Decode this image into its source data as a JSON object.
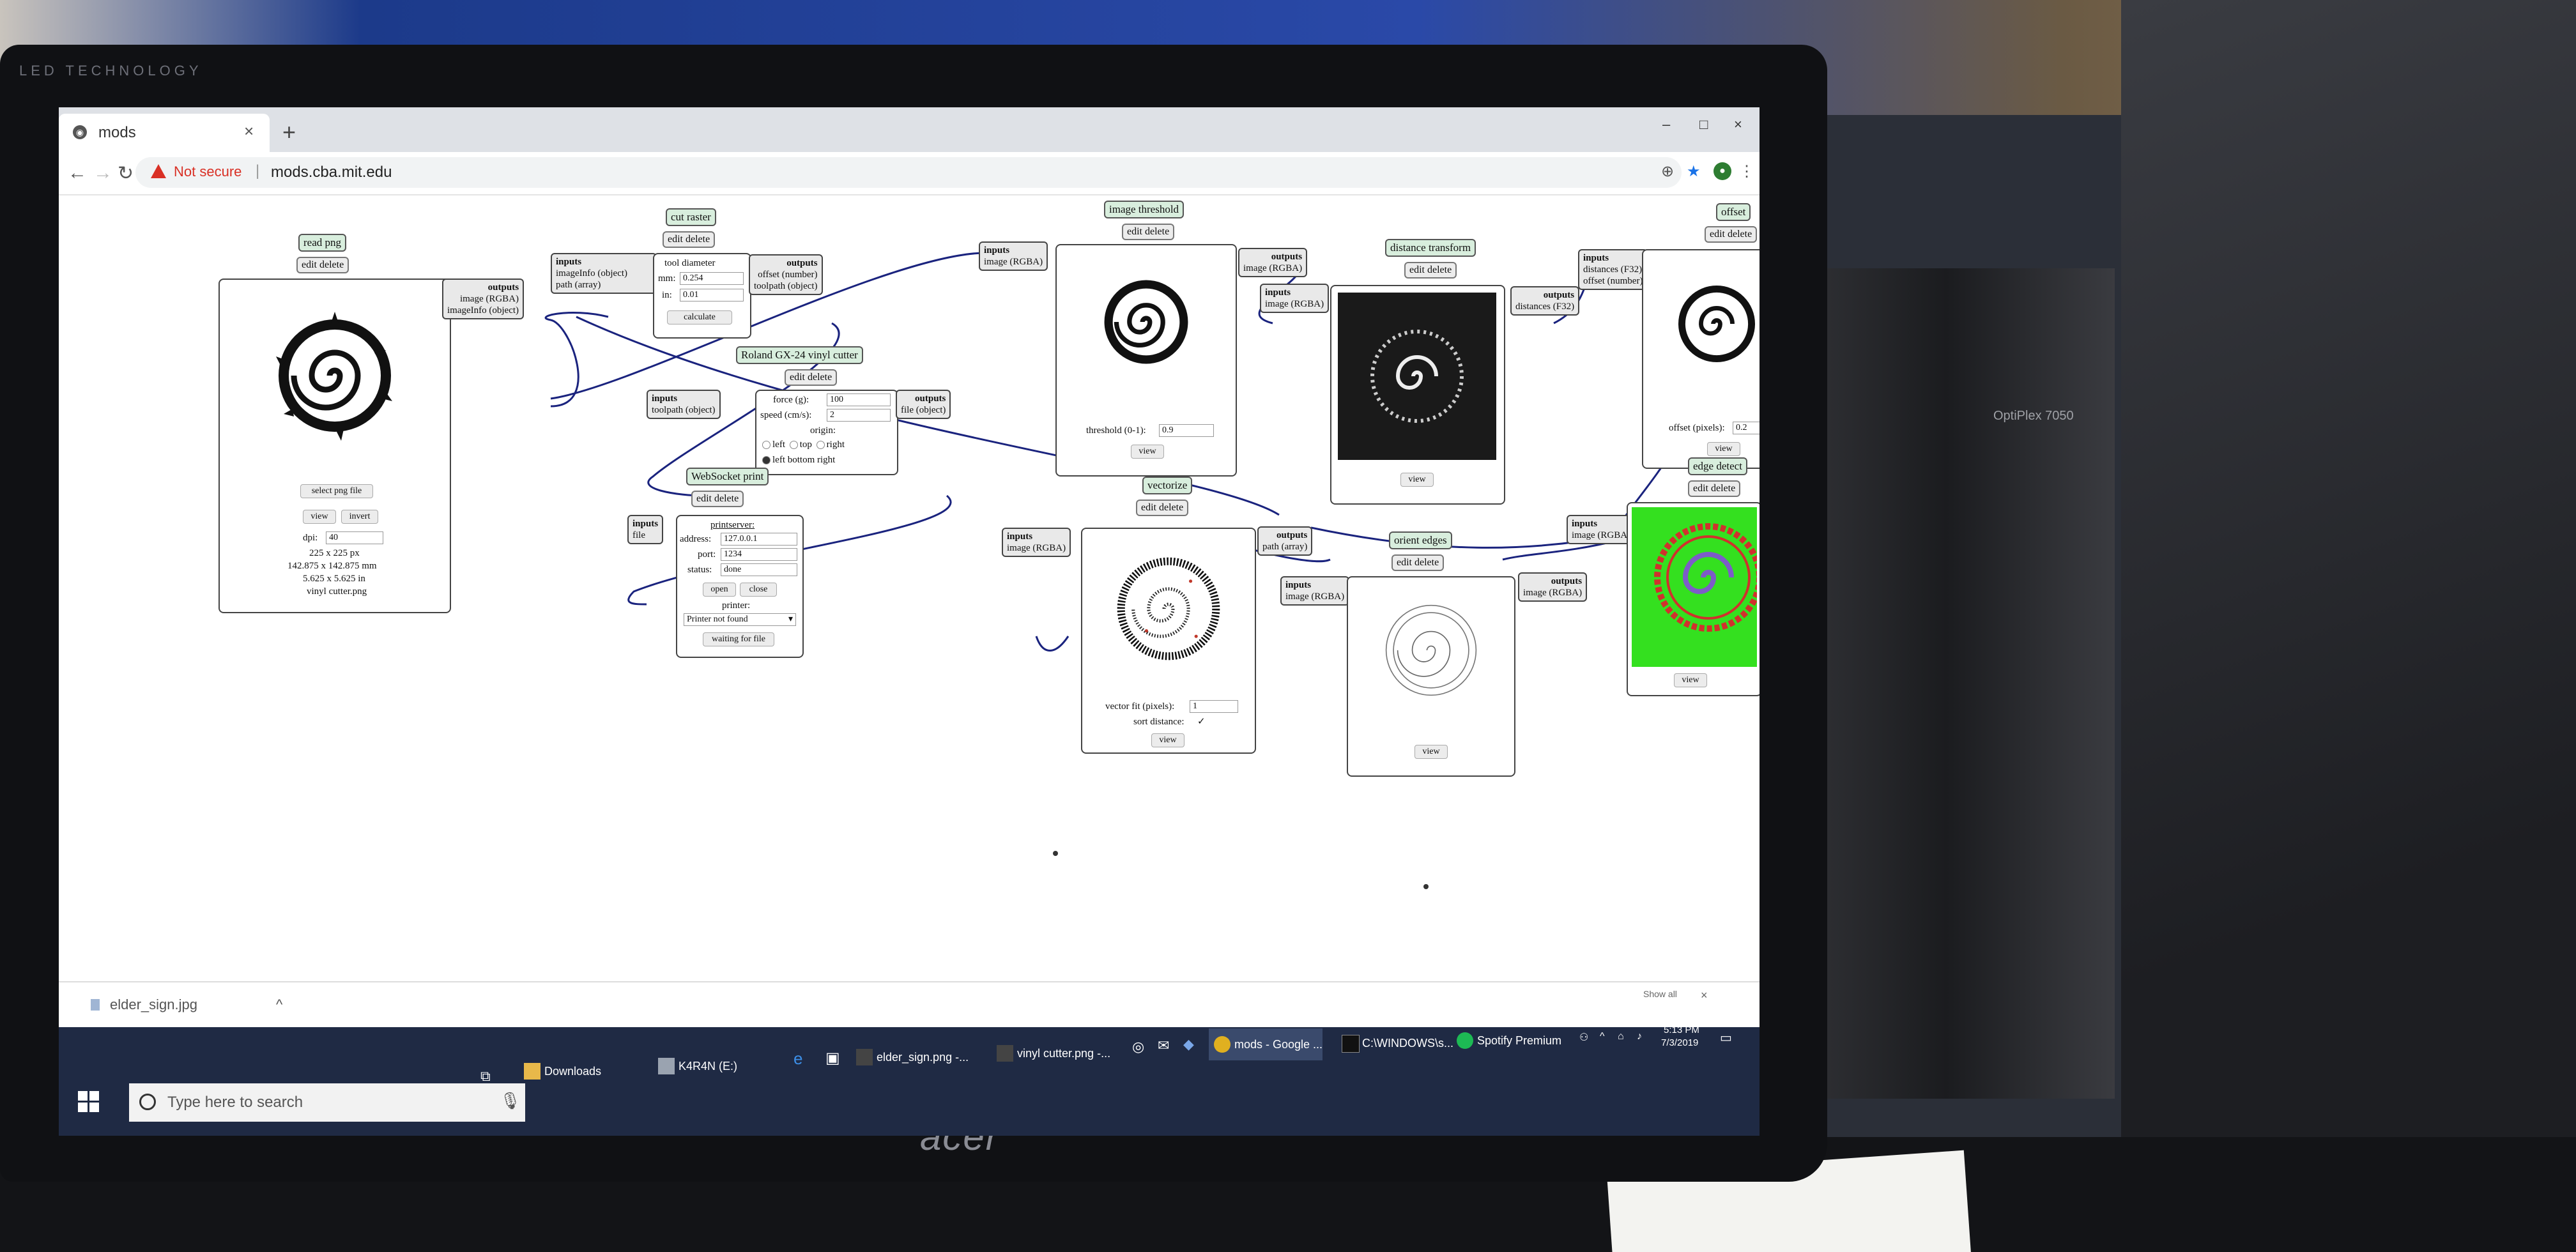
{
  "browser": {
    "tab_title": "mods",
    "tab_close": "×",
    "new_tab": "+",
    "not_secure": "Not secure",
    "separator": "|",
    "url": "mods.cba.mit.edu",
    "window_controls": [
      "–",
      "□",
      "×"
    ]
  },
  "modules": {
    "read_png": {
      "title": "read png",
      "edit_delete": "edit delete",
      "outputs_label": "outputs",
      "outputs": [
        "image (RGBA)",
        "imageInfo (object)"
      ],
      "select_button": "select png file",
      "view_button": "view",
      "invert_button": "invert",
      "dpi_label": "dpi:",
      "dpi_value": "40",
      "size_px": "225 x 225 px",
      "size_mm": "142.875 x 142.875 mm",
      "size_in": "5.625 x 5.625 in",
      "filename": "vinyl cutter.png"
    },
    "cut_raster": {
      "title": "cut raster",
      "edit_delete": "edit delete",
      "inputs_label": "inputs",
      "inputs": [
        "imageInfo (object)",
        "path (array)"
      ],
      "outputs_label": "outputs",
      "outputs": [
        "offset (number)",
        "toolpath (object)"
      ],
      "tool_diameter_label": "tool diameter",
      "mm_label": "mm:",
      "mm_value": "0.254",
      "in_label": "in:",
      "in_value": "0.01",
      "calculate_button": "calculate"
    },
    "roland": {
      "title": "Roland GX-24 vinyl cutter",
      "edit_delete": "edit delete",
      "inputs_label": "inputs",
      "inputs": [
        "toolpath (object)"
      ],
      "outputs_label": "outputs",
      "outputs": [
        "file (object)"
      ],
      "force_label": "force (g):",
      "force_value": "100",
      "speed_label": "speed (cm/s):",
      "speed_value": "2",
      "origin_label": "origin:",
      "origin_row1": [
        "left",
        "top",
        "right"
      ],
      "origin_row2": "left bottom right"
    },
    "websocket": {
      "title": "WebSocket print",
      "edit_delete": "edit delete",
      "inputs_label": "inputs",
      "inputs": [
        "file"
      ],
      "printserver_label": "printserver:",
      "address_label": "address:",
      "address_value": "127.0.0.1",
      "port_label": "port:",
      "port_value": "1234",
      "status_label": "status:",
      "status_value": "done",
      "open_button": "open",
      "close_button": "close",
      "printer_label": "printer:",
      "printer_value": "Printer not found",
      "waiting_button": "waiting for file"
    },
    "image_threshold": {
      "title": "image threshold",
      "edit_delete": "edit delete",
      "inputs_label": "inputs",
      "inputs": [
        "image (RGBA)"
      ],
      "outputs_label": "outputs",
      "outputs": [
        "image (RGBA)"
      ],
      "threshold_label": "threshold (0-1):",
      "threshold_value": "0.9",
      "view_button": "view"
    },
    "distance_transform": {
      "title": "distance transform",
      "edit_delete": "edit delete",
      "inputs_label": "inputs",
      "inputs": [
        "image (RGBA)"
      ],
      "outputs_label": "outputs",
      "outputs": [
        "distances (F32)"
      ],
      "view_button": "view"
    },
    "offset": {
      "title": "offset",
      "edit_delete": "edit delete",
      "inputs_label": "inputs",
      "inputs": [
        "distances (F32)",
        "offset (number)"
      ],
      "offset_label": "offset (pixels):",
      "offset_value": "0.2",
      "view_button": "view"
    },
    "vectorize": {
      "title": "vectorize",
      "edit_delete": "edit delete",
      "inputs_label": "inputs",
      "inputs": [
        "image (RGBA)"
      ],
      "outputs_label": "outputs",
      "outputs": [
        "path (array)"
      ],
      "vector_fit_label": "vector fit (pixels):",
      "vector_fit_value": "1",
      "sort_label": "sort distance:",
      "sort_checked": "✓",
      "view_button": "view"
    },
    "orient_edges": {
      "title": "orient edges",
      "edit_delete": "edit delete",
      "inputs_label": "inputs",
      "inputs": [
        "image (RGBA)"
      ],
      "outputs_label": "outputs",
      "outputs": [
        "image (RGBA)"
      ],
      "view_button": "view"
    },
    "edge_detect": {
      "title": "edge detect",
      "edit_delete": "edit delete",
      "inputs_label": "inputs",
      "inputs": [
        "image (RGBA)"
      ],
      "view_button": "view"
    }
  },
  "downloads": {
    "file": "elder_sign.jpg",
    "show_all": "Show all",
    "close": "×"
  },
  "taskbar": {
    "search_placeholder": "Type here to search",
    "items": [
      {
        "label": "Downloads",
        "icon": "folder-icon",
        "active": false
      },
      {
        "label": "K4R4N (E:)",
        "icon": "drive-icon",
        "active": false
      },
      {
        "label": "elder_sign.png -...",
        "icon": "inkscape-icon",
        "active": false
      },
      {
        "label": "vinyl cutter.png -...",
        "icon": "inkscape-icon",
        "active": false
      },
      {
        "label": "mods - Google ...",
        "icon": "chrome-icon",
        "active": true
      },
      {
        "label": "C:\\WINDOWS\\s...",
        "icon": "cmd-icon",
        "active": false
      },
      {
        "label": "Spotify Premium",
        "icon": "spotify-icon",
        "active": false
      }
    ],
    "time": "5:13 PM",
    "date": "7/3/2019"
  },
  "hardware": {
    "bezel_brand": "LED TECHNOLOGY",
    "monitor_logo": "acer",
    "tower_label": "OptiPlex 7050"
  },
  "colors": {
    "module_title_bg": "#d8eedd",
    "wire": "#1a237e",
    "edge_detect_bg": "#34e01f",
    "edge_detect_trace": "#d0312d",
    "taskbar_bg": "#1f2a44",
    "warning_red": "#d93025"
  }
}
